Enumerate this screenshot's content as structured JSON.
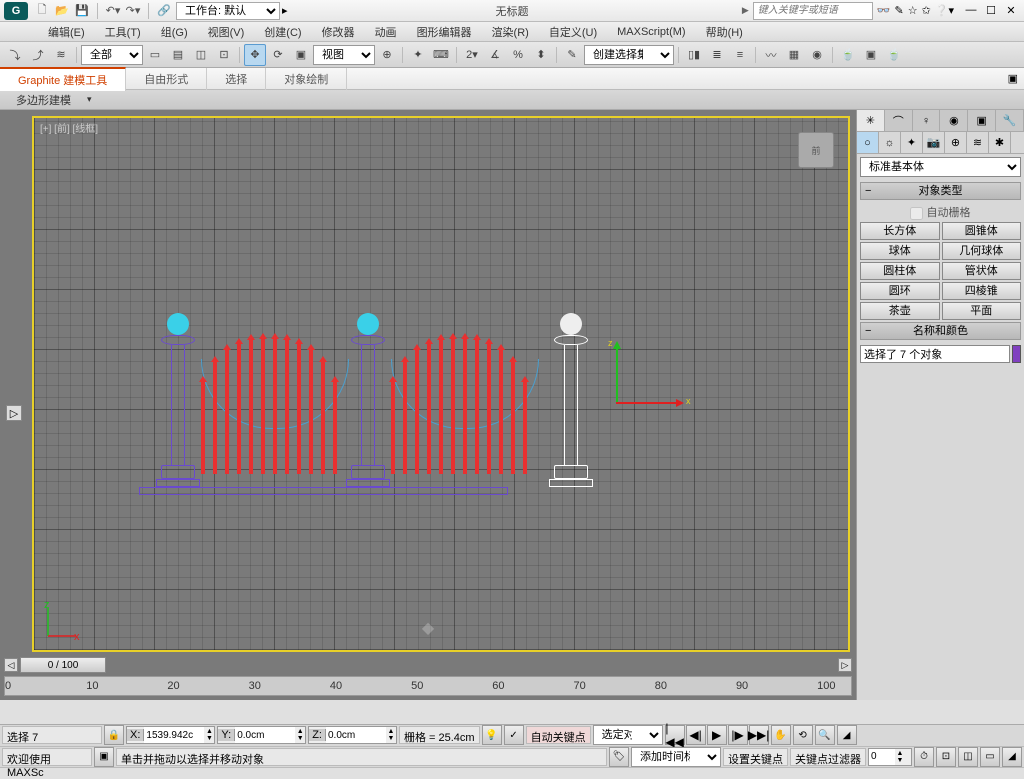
{
  "title": "无标题",
  "workspace": "工作台: 默认",
  "search_placeholder": "键入关键字或短语",
  "menu": {
    "edit": "编辑(E)",
    "tools": "工具(T)",
    "group": "组(G)",
    "views": "视图(V)",
    "create": "创建(C)",
    "modifiers": "修改器",
    "anim": "动画",
    "graph": "图形编辑器",
    "render": "渲染(R)",
    "custom": "自定义(U)",
    "max": "MAXScript(M)",
    "help": "帮助(H)"
  },
  "main_toolbar": {
    "all": "全部",
    "view": "视图",
    "selset": "创建选择集"
  },
  "ribbon": {
    "graphite": "Graphite 建模工具",
    "freeform": "自由形式",
    "select": "选择",
    "paint": "对象绘制",
    "poly": "多边形建模"
  },
  "viewport_label": "[+] [前] [线框]",
  "viewcube_face": "前",
  "axis": {
    "x": "x",
    "z": "z"
  },
  "cmd": {
    "dropdown": "标准基本体",
    "rollout_type": "对象类型",
    "autogrid": "自动栅格",
    "btns": {
      "box": "长方体",
      "cone": "圆锥体",
      "sphere": "球体",
      "geo": "几何球体",
      "cyl": "圆柱体",
      "tube": "管状体",
      "torus": "圆环",
      "pyr": "四棱锥",
      "tea": "茶壶",
      "plane": "平面"
    },
    "rollout_name": "名称和颜色",
    "name_value": "选择了 7 个对象"
  },
  "timeline": {
    "frame": "0 / 100",
    "ticks": [
      "0",
      "10",
      "20",
      "30",
      "40",
      "50",
      "60",
      "70",
      "80",
      "90",
      "100"
    ]
  },
  "status": {
    "welcome": "欢迎使用 MAXSc",
    "sel_label": "选择",
    "sel_count": "7",
    "x": "1539.942c",
    "y": "0.0cm",
    "z": "0.0cm",
    "grid": "栅格 = 25.4cm",
    "autokey": "自动关键点",
    "selobj": "选定对象",
    "setkey": "设置关键点",
    "keyfilter": "关键点过滤器",
    "hint": "单击并拖动以选择并移动对象",
    "addtag": "添加时间标记"
  }
}
